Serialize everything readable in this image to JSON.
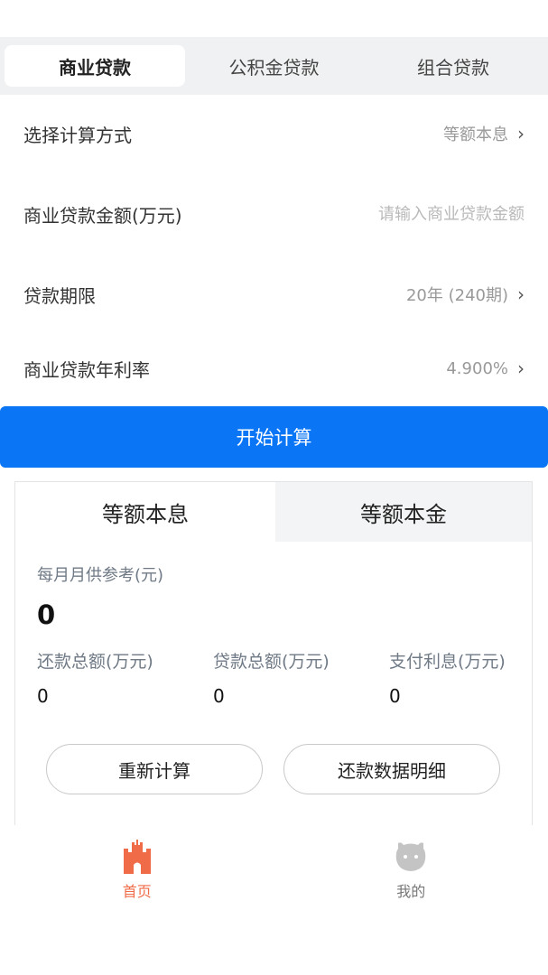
{
  "loan_tabs": [
    {
      "label": "商业贷款",
      "active": true
    },
    {
      "label": "公积金贷款",
      "active": false
    },
    {
      "label": "组合贷款",
      "active": false
    }
  ],
  "form": {
    "method": {
      "label": "选择计算方式",
      "value": "等额本息"
    },
    "amount": {
      "label": "商业贷款金额(万元)",
      "placeholder": "请输入商业贷款金额",
      "value": ""
    },
    "term": {
      "label": "贷款期限",
      "value": "20年 (240期)"
    },
    "rate": {
      "label": "商业贷款年利率",
      "value": "4.900%"
    }
  },
  "calculate_button": "开始计算",
  "result": {
    "tabs": [
      {
        "label": "等额本息",
        "active": true
      },
      {
        "label": "等额本金",
        "active": false
      }
    ],
    "monthly_label": "每月月供参考(元)",
    "monthly_value": "0",
    "stats": [
      {
        "label": "还款总额(万元)",
        "value": "0"
      },
      {
        "label": "贷款总额(万元)",
        "value": "0"
      },
      {
        "label": "支付利息(万元)",
        "value": "0"
      }
    ],
    "recalc_button": "重新计算",
    "detail_button": "还款数据明细"
  },
  "bottom_nav": [
    {
      "label": "首页",
      "icon": "castle-icon",
      "active": true
    },
    {
      "label": "我的",
      "icon": "cat-face-icon",
      "active": false
    }
  ],
  "colors": {
    "primary": "#0a76f6",
    "nav_active": "#f06b47",
    "nav_inactive": "#bfbfbf"
  }
}
